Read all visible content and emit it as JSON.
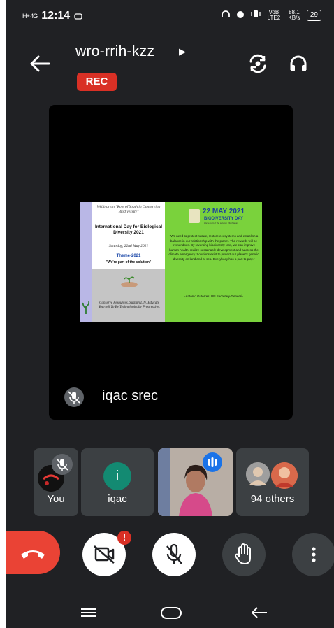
{
  "status_bar": {
    "signal": "H+ 4G",
    "time": "12:14",
    "vo_lte": "VoB LTE2",
    "speed": "88.1 KB/s",
    "battery": "29"
  },
  "header": {
    "meeting_code": "wro-rrih-kzz",
    "rec_label": "REC"
  },
  "main_tile": {
    "participant_name": "iqac srec",
    "slide": {
      "webinar_line": "Webinar on \"Role of Youth in Conserving Biodiversity\"",
      "title": "International Day for Biological Diversity 2021",
      "date": "Saturday, 22nd May 2021",
      "theme_label": "Theme-2021",
      "theme_text": "\"We're part of the solution\"",
      "conserve_text": "Conserve Resources, Sustain Life. Educate Yourself To Be Technologically Progressive.",
      "big_date": "22 MAY 2021",
      "bio_day": "BIODIVERSITY DAY",
      "bio_day_sub": "We're part of the solution #ForNature",
      "quote": "\"We need to protect nature, restore ecosystems and establish a balance in our relationship with the planet. The rewards will be tremendous. By reversing biodiversity loss, we can improve human health, realize sustainable development and address the climate emergency. Solutions exist to protect our planet's genetic diversity on land and at sea. Everybody has a part to play.\"",
      "attribution": "-Antonio Guterres, UN Secretary-General-"
    }
  },
  "participants": [
    {
      "name": "You"
    },
    {
      "name": "iqac",
      "initial": "i"
    },
    {
      "name": ""
    },
    {
      "name": "94 others"
    }
  ],
  "controls": {
    "camera_badge": "!"
  },
  "colors": {
    "background": "#202124",
    "end_call": "#ea4335",
    "rec": "#d93025",
    "iqac_avatar": "#138a72",
    "speaking": "#1a73e8"
  }
}
